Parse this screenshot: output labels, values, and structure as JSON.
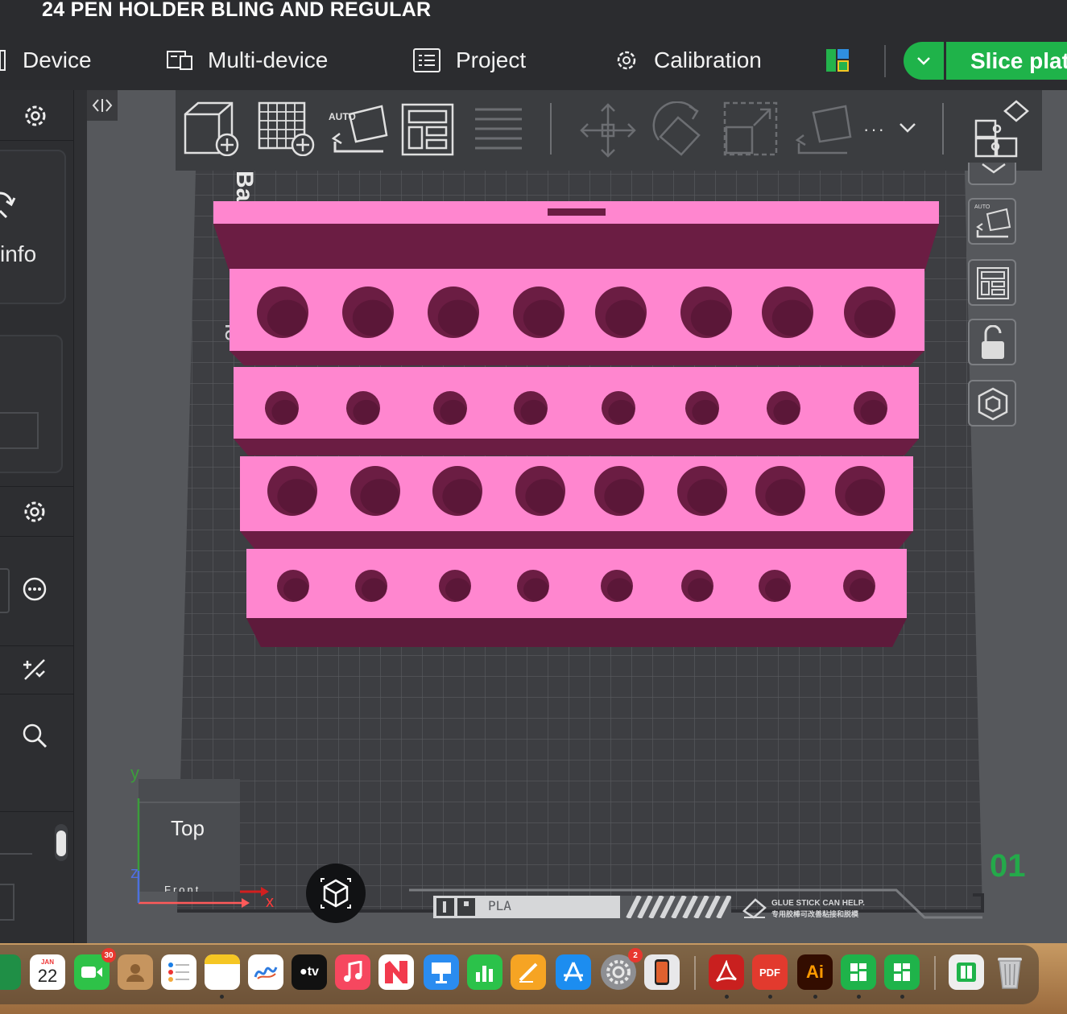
{
  "window": {
    "title": "24 PEN HOLDER BLING AND REGULAR"
  },
  "nav": {
    "device": "Device",
    "multi_device": "Multi-device",
    "project": "Project",
    "calibration": "Calibration",
    "slice_plate": "Slice plate"
  },
  "left_panel": {
    "info_label": "info"
  },
  "viewport": {
    "view_cube_top": "Top",
    "view_cube_front": "Front",
    "axis_x": "x",
    "axis_y": "y",
    "axis_z": "z",
    "plate_number": "01",
    "plate_material": "PLA",
    "plate_tip_line1": "GLUE STICK CAN HELP.",
    "plate_tip_line2": "专用胶棒可改善粘接和脱模",
    "model_color": "#ff86cf",
    "model_shadow": "#6b1d43"
  },
  "toolbar": {
    "auto_label": "AUTO",
    "more_label": "···"
  },
  "dock": {
    "calendar_month": "JAN",
    "calendar_day": "22",
    "facetime_badge": "30",
    "settings_badge": "2",
    "tv_label": "tv",
    "pdf_label": "PDF",
    "ai_label": "Ai"
  }
}
